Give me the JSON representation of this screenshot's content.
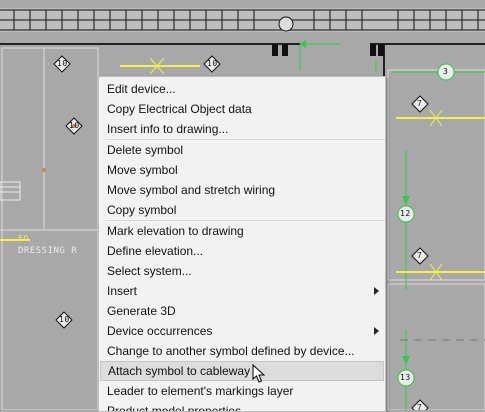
{
  "drawing": {
    "room_label": "DRESSING R",
    "small_label": "FO",
    "tags": [
      "10",
      "10",
      "10",
      "10",
      "7",
      "7",
      "7",
      "3",
      "12",
      "13"
    ]
  },
  "context_menu": {
    "items": [
      {
        "label": "Edit device...",
        "submenu": false
      },
      {
        "label": "Copy Electrical Object data",
        "submenu": false
      },
      {
        "label": "Insert info to drawing...",
        "submenu": false
      },
      {
        "label": "Delete symbol",
        "submenu": false
      },
      {
        "label": "Move symbol",
        "submenu": false
      },
      {
        "label": "Move symbol and stretch wiring",
        "submenu": false
      },
      {
        "label": "Copy symbol",
        "submenu": false
      },
      {
        "label": "Mark elevation to drawing",
        "submenu": false
      },
      {
        "label": "Define elevation...",
        "submenu": false
      },
      {
        "label": "Select system...",
        "submenu": false
      },
      {
        "label": "Insert",
        "submenu": true
      },
      {
        "label": "Generate 3D",
        "submenu": false
      },
      {
        "label": "Device occurrences",
        "submenu": true
      },
      {
        "label": "Change to another symbol defined by device...",
        "submenu": false
      },
      {
        "label": "Attach symbol to cableway",
        "submenu": false,
        "highlighted": true
      },
      {
        "label": "Leader to element's markings layer",
        "submenu": false
      },
      {
        "label": "Product model properties",
        "submenu": false
      }
    ]
  },
  "colors": {
    "background": "#a8a8a8",
    "cad_lines": "#1a1a1a",
    "wiring_green": "#2ecc40",
    "cable_yellow": "#f0f050",
    "menu_bg": "#f2f2f2",
    "menu_highlight": "#dcdcdc"
  }
}
